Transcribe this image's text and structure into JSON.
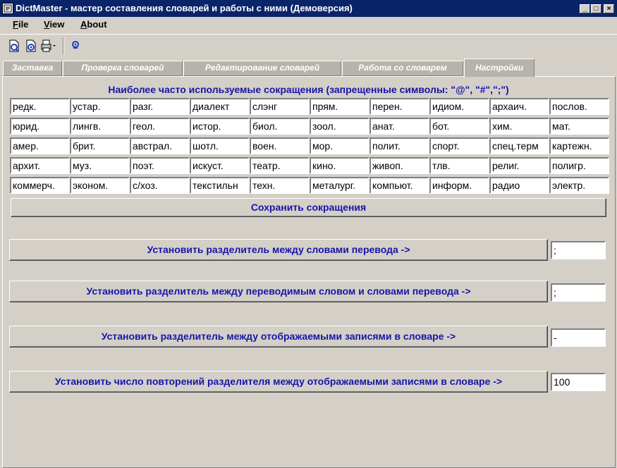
{
  "window": {
    "title": "DictMaster - мастер составления словарей и работы с ними (Демоверсия)",
    "min": "_",
    "max": "□",
    "close": "×"
  },
  "menu": [
    {
      "mn": "F",
      "rest": "ile"
    },
    {
      "mn": "V",
      "rest": "iew"
    },
    {
      "mn": "A",
      "rest": "bout"
    }
  ],
  "tabs": [
    "Заставка",
    "Проверка словарей",
    "Редактирование словарей",
    "Работа со словарем",
    "Настройки"
  ],
  "abbrev": {
    "heading": "Наиболее часто используемые сокращения (запрещенные символы: \"@\", \"#\",\";\")",
    "rows": [
      [
        "редк.",
        "устар.",
        "разг.",
        "диалект",
        "слэнг",
        "прям.",
        "перен.",
        "идиом.",
        "архаич.",
        "послов."
      ],
      [
        "юрид.",
        "лингв.",
        "геол.",
        "истор.",
        "биол.",
        "зоол.",
        "анат.",
        "бот.",
        "хим.",
        "мат."
      ],
      [
        "амер.",
        "брит.",
        "австрал.",
        "шотл.",
        "воен.",
        "мор.",
        "полит.",
        "спорт.",
        "спец.терм",
        "картежн."
      ],
      [
        "архит.",
        "муз.",
        "поэт.",
        "искуст.",
        "театр.",
        "кино.",
        "живоп.",
        "тлв.",
        "религ.",
        "полигр."
      ],
      [
        "коммерч.",
        "эконом.",
        "с/хоз.",
        "текстильн",
        "техн.",
        "металург.",
        "компьют.",
        "информ.",
        "радио",
        "электр."
      ]
    ],
    "save_label": "Сохранить сокращения"
  },
  "settings": [
    {
      "label": "Установить разделитель между словами перевода  ->",
      "value": ";"
    },
    {
      "label": "Установить разделитель между переводимым словом и словами перевода  ->",
      "value": ";"
    },
    {
      "label": "Установить разделитель между отображаемыми записями в словаре  ->",
      "value": "-"
    },
    {
      "label": "Установить число повторений разделителя между отображаемыми записями в словаре  ->",
      "value": "100"
    }
  ]
}
